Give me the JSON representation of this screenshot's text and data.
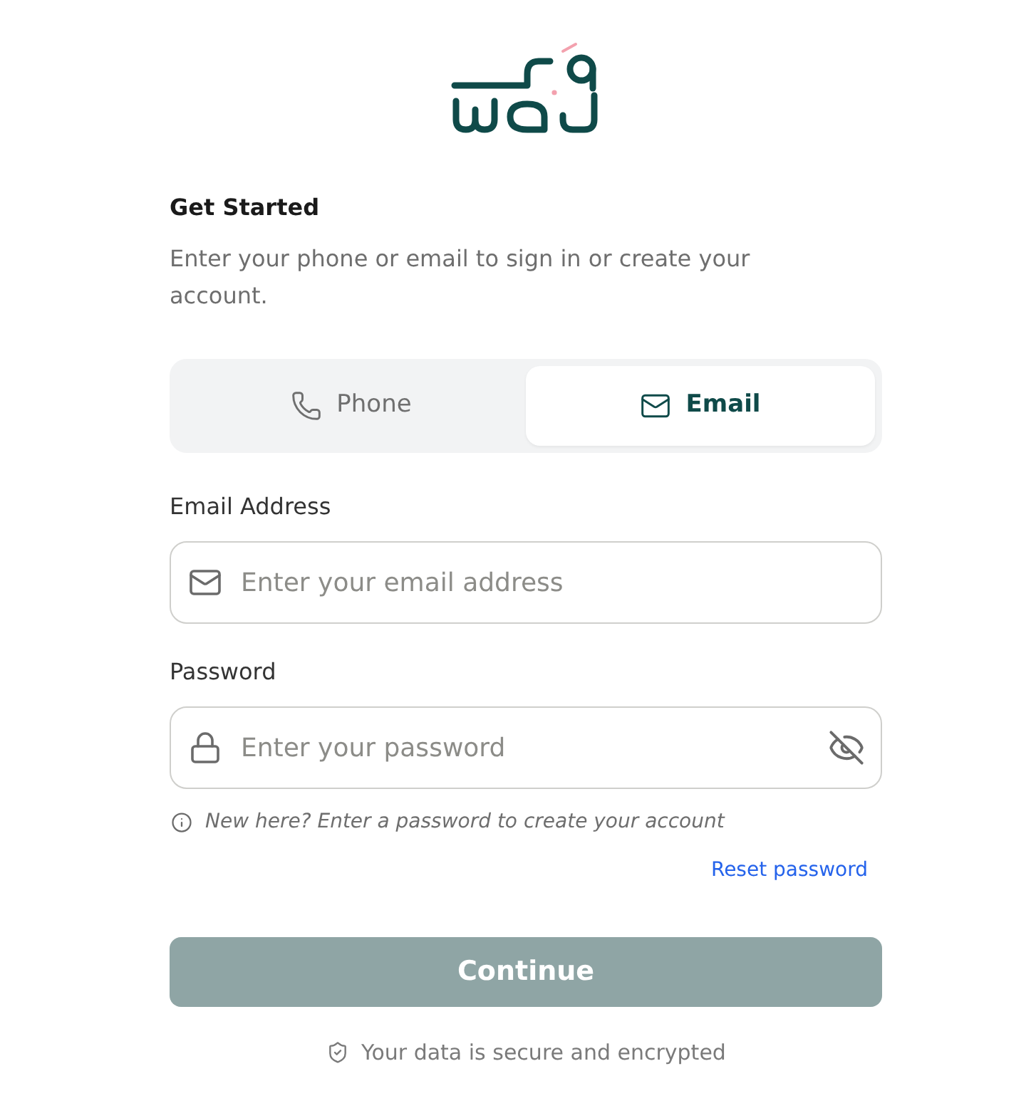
{
  "intro": {
    "title": "Get Started",
    "description": "Enter your phone or email to sign in or create your account."
  },
  "tabs": [
    {
      "kind": "phone",
      "label": "Phone",
      "selected": false
    },
    {
      "kind": "email",
      "label": "Email",
      "selected": true
    }
  ],
  "fields": [
    {
      "kind": "email",
      "label": "Email Address",
      "placeholder": "Enter your email address"
    },
    {
      "kind": "password",
      "label": "Password",
      "placeholder": "Enter your password",
      "show_password": false
    }
  ],
  "hint": "New here? Enter a password to create your account",
  "reset_link": "Reset password",
  "continue_button": {
    "label": "Continue",
    "disabled": true
  },
  "footer_note": "Your data is secure and encrypted"
}
